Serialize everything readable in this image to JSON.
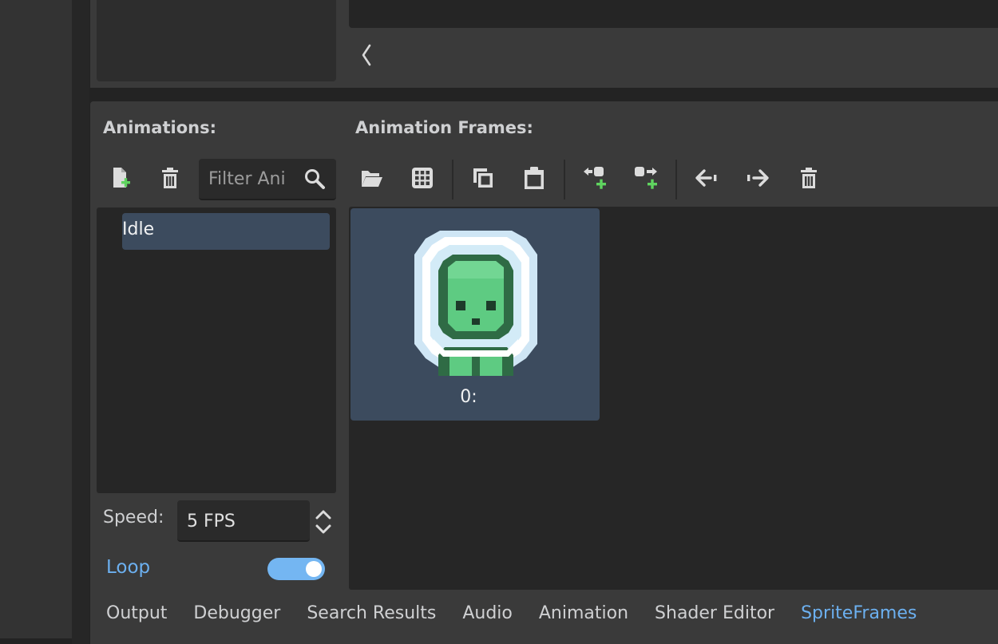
{
  "animations_panel": {
    "title": "Animations:",
    "filter_placeholder": "Filter Ani",
    "items": [
      "Idle"
    ],
    "selected": "Idle",
    "speed_label": "Speed:",
    "speed_value": "5 FPS",
    "loop_label": "Loop",
    "loop_enabled": true
  },
  "frames_panel": {
    "title": "Animation Frames:",
    "frames": [
      {
        "label": "0:"
      }
    ]
  },
  "bottom_tabs": [
    "Output",
    "Debugger",
    "Search Results",
    "Audio",
    "Animation",
    "Shader Editor",
    "SpriteFrames"
  ],
  "active_tab": "SpriteFrames",
  "icons": {
    "new_animation": "new-animation-icon",
    "delete_animation": "trash-icon",
    "search": "search-icon",
    "load_frames": "folder-open-icon",
    "sprite_sheet": "grid-icon",
    "copy": "copy-icon",
    "paste": "paste-icon",
    "insert_before": "insert-before-icon",
    "insert_after": "insert-after-icon",
    "move_left": "move-left-icon",
    "move_right": "move-right-icon",
    "delete_frame": "trash-icon",
    "collapse": "chevron-left-icon"
  },
  "colors": {
    "accent": "#6cb0f0",
    "selection": "#3c4b5e",
    "panel": "#3a3a3a",
    "well": "#262626",
    "plus_green": "#5fd45f"
  }
}
